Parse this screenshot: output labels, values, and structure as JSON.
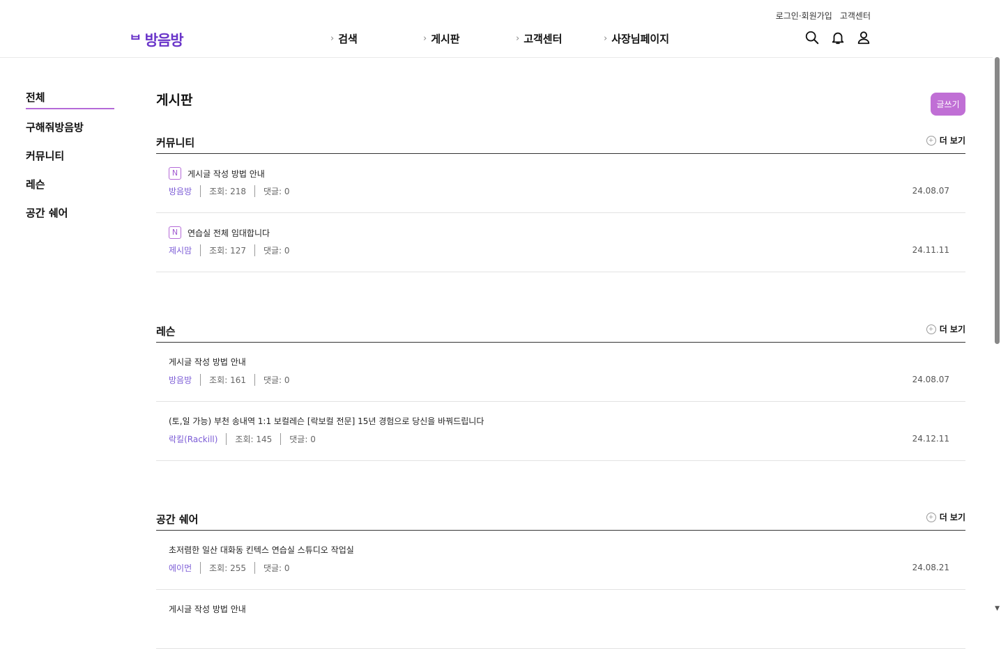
{
  "header": {
    "util_links": [
      "로그인·회원가입",
      "고객센터"
    ],
    "logo_text": "방음방",
    "logo_mark": "ᄇ",
    "nav": [
      "검색",
      "게시판",
      "고객센터",
      "사장님페이지"
    ],
    "icons": [
      "search-icon",
      "bell-icon",
      "user-icon"
    ]
  },
  "sidebar": {
    "items": [
      "전체",
      "구해줘방음방",
      "커뮤니티",
      "레슨",
      "공간 쉐어"
    ],
    "active": "전체"
  },
  "main": {
    "title": "게시판",
    "write_button": "글쓰기",
    "more_label": "더 보기",
    "sections": [
      {
        "title": "커뮤니티",
        "posts": [
          {
            "badge": "N",
            "title": "게시글 작성 방법 안내",
            "author": "방음방",
            "views": "조회: 218",
            "comments": "댓글: 0",
            "date": "24.08.07"
          },
          {
            "badge": "N",
            "title": "연습실 전체 임대합니다",
            "author": "제시맘",
            "views": "조회: 127",
            "comments": "댓글: 0",
            "date": "24.11.11"
          }
        ]
      },
      {
        "title": "레슨",
        "posts": [
          {
            "badge": "",
            "title": "게시글 작성 방법 안내",
            "author": "방음방",
            "views": "조회: 161",
            "comments": "댓글: 0",
            "date": "24.08.07"
          },
          {
            "badge": "",
            "title": "(토,일 가능) 부천 송내역 1:1 보컬레슨 [락보컬 전문] 15년 경험으로 당신을 바꿔드립니다",
            "author": "락킬(Rackill)",
            "views": "조회: 145",
            "comments": "댓글: 0",
            "date": "24.12.11"
          }
        ]
      },
      {
        "title": "공간 쉐어",
        "posts": [
          {
            "badge": "",
            "title": "초저렴한 일산 대화동 킨텍스 연습실 스튜디오 작업실",
            "author": "에이먼",
            "views": "조회: 255",
            "comments": "댓글: 0",
            "date": "24.08.21"
          },
          {
            "badge": "",
            "title": "게시글 작성 방법 안내",
            "author": "",
            "views": "",
            "comments": "",
            "date": ""
          }
        ]
      }
    ]
  },
  "colors": {
    "accent": "#6a35c9",
    "button": "#c06fd5",
    "badge": "#b46ad8",
    "author": "#7b5bd6"
  }
}
